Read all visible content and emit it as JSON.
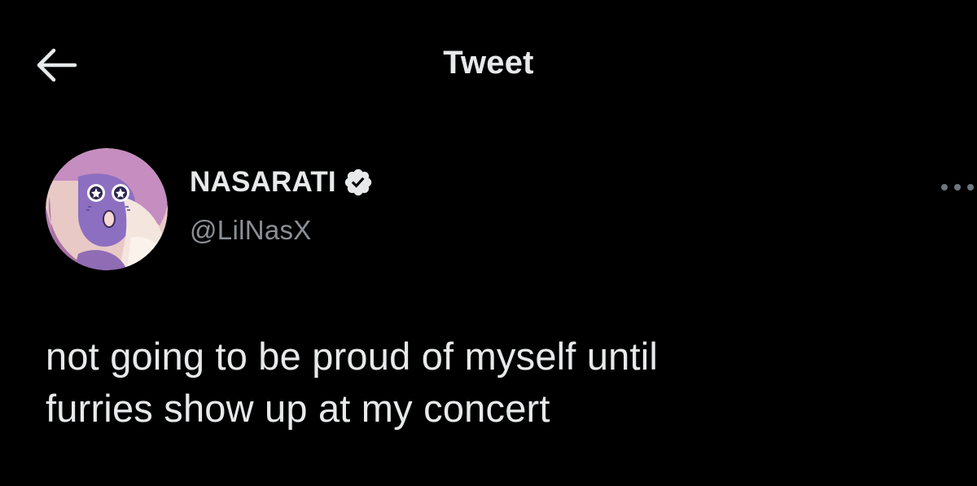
{
  "header": {
    "title": "Tweet",
    "back_icon": "arrow-left-icon"
  },
  "author": {
    "display_name": "NASARATI",
    "handle": "@LilNasX",
    "verified": true,
    "verified_icon": "verified-badge-icon",
    "avatar_icon": "cartoon-avatar-image",
    "more_icon": "more-horizontal-icon"
  },
  "tweet": {
    "line1": "not going to be proud of myself until",
    "line2": "furries show up at my concert"
  },
  "colors": {
    "background": "#000000",
    "primary_text": "#e7e9ea",
    "secondary_text": "#8b9096",
    "avatar_bg": "#b983b6"
  }
}
